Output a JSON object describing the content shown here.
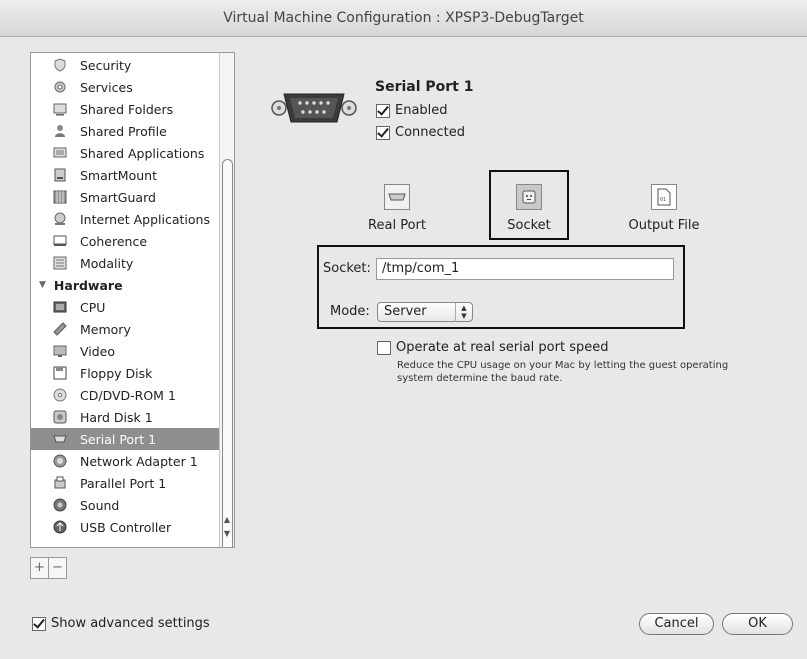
{
  "window": {
    "title": "Virtual Machine Configuration : XPSP3-DebugTarget"
  },
  "sidebar": {
    "items": [
      {
        "label": "Security",
        "icon": "shield-icon"
      },
      {
        "label": "Services",
        "icon": "services-icon"
      },
      {
        "label": "Shared Folders",
        "icon": "shared-folders-icon"
      },
      {
        "label": "Shared Profile",
        "icon": "shared-profile-icon"
      },
      {
        "label": "Shared Applications",
        "icon": "shared-applications-icon"
      },
      {
        "label": "SmartMount",
        "icon": "smartmount-icon"
      },
      {
        "label": "SmartGuard",
        "icon": "smartguard-icon"
      },
      {
        "label": "Internet Applications",
        "icon": "internet-applications-icon"
      },
      {
        "label": "Coherence",
        "icon": "coherence-icon"
      },
      {
        "label": "Modality",
        "icon": "modality-icon"
      }
    ],
    "hardware_header": "Hardware",
    "hardware_items": [
      {
        "label": "CPU",
        "icon": "cpu-icon"
      },
      {
        "label": "Memory",
        "icon": "memory-icon"
      },
      {
        "label": "Video",
        "icon": "video-icon"
      },
      {
        "label": "Floppy Disk",
        "icon": "floppy-disk-icon"
      },
      {
        "label": "CD/DVD-ROM 1",
        "icon": "cd-dvd-icon"
      },
      {
        "label": "Hard Disk 1",
        "icon": "hard-disk-icon"
      },
      {
        "label": "Serial Port 1",
        "icon": "serial-port-icon",
        "selected": true
      },
      {
        "label": "Network Adapter 1",
        "icon": "network-adapter-icon"
      },
      {
        "label": "Parallel Port 1",
        "icon": "parallel-port-icon"
      },
      {
        "label": "Sound",
        "icon": "sound-icon"
      },
      {
        "label": "USB Controller",
        "icon": "usb-controller-icon"
      }
    ],
    "add_label": "+",
    "remove_label": "−"
  },
  "device": {
    "title": "Serial Port 1",
    "enabled_label": "Enabled",
    "enabled": true,
    "connected_label": "Connected",
    "connected": true
  },
  "port_types": {
    "real_port": "Real Port",
    "socket": "Socket",
    "output_file": "Output File",
    "selected": "Socket"
  },
  "socket_settings": {
    "socket_label": "Socket:",
    "socket_value": "/tmp/com_1",
    "mode_label": "Mode:",
    "mode_value": "Server"
  },
  "real_speed": {
    "label": "Operate at real serial port speed",
    "checked": false,
    "help": "Reduce the CPU usage on your Mac by letting the guest operating system determine the baud rate."
  },
  "footer": {
    "advanced_label": "Show advanced settings",
    "advanced_checked": true,
    "cancel_label": "Cancel",
    "ok_label": "OK"
  }
}
